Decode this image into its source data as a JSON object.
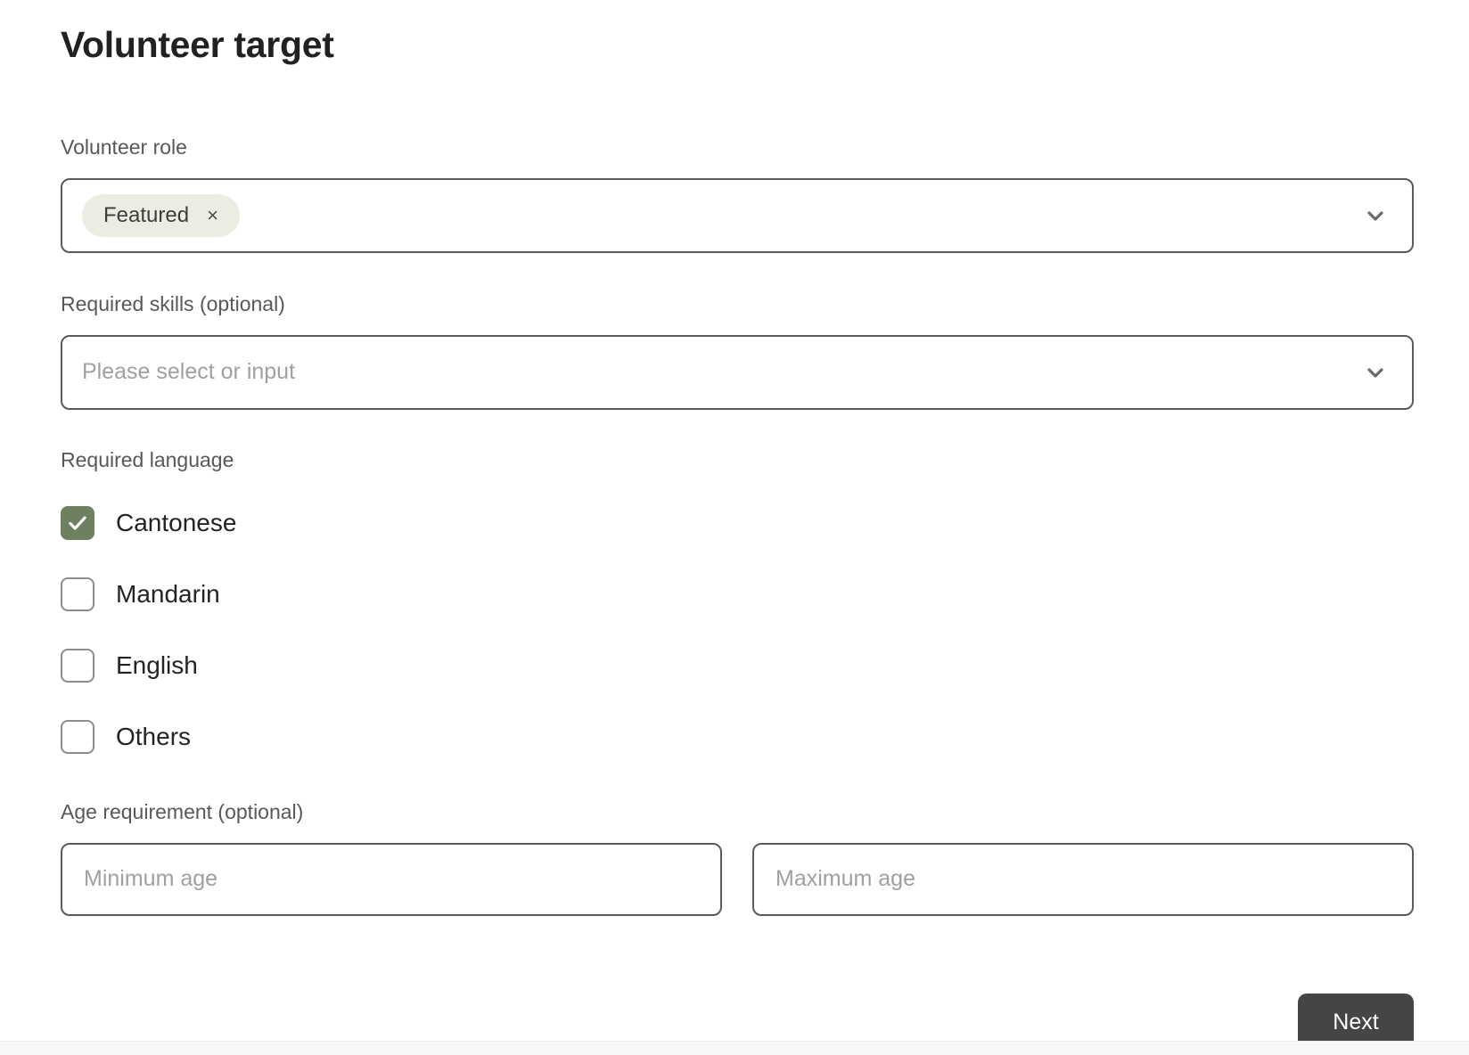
{
  "page": {
    "title": "Volunteer target"
  },
  "fields": {
    "volunteer_role": {
      "label": "Volunteer role",
      "chips": [
        {
          "text": "Featured",
          "remove_glyph": "×"
        }
      ],
      "chevron_icon": "chevron-down-icon"
    },
    "required_skills": {
      "label": "Required skills (optional)",
      "placeholder": "Please select or input",
      "value": "",
      "chevron_icon": "chevron-down-icon"
    },
    "required_language": {
      "label": "Required language",
      "options": [
        {
          "label": "Cantonese",
          "checked": true
        },
        {
          "label": "Mandarin",
          "checked": false
        },
        {
          "label": "English",
          "checked": false
        },
        {
          "label": "Others",
          "checked": false
        }
      ]
    },
    "age_requirement": {
      "label": "Age requirement (optional)",
      "minimum": {
        "placeholder": "Minimum age",
        "value": ""
      },
      "maximum": {
        "placeholder": "Maximum age",
        "value": ""
      }
    }
  },
  "footer": {
    "next_label": "Next"
  },
  "colors": {
    "accent_checked": "#6e8060",
    "chip_background": "#edece3",
    "button_background": "#454545",
    "border": "#5b5b5b",
    "label_text": "#58585a",
    "title_text": "#21211f",
    "placeholder_text": "#a0a0a0"
  }
}
